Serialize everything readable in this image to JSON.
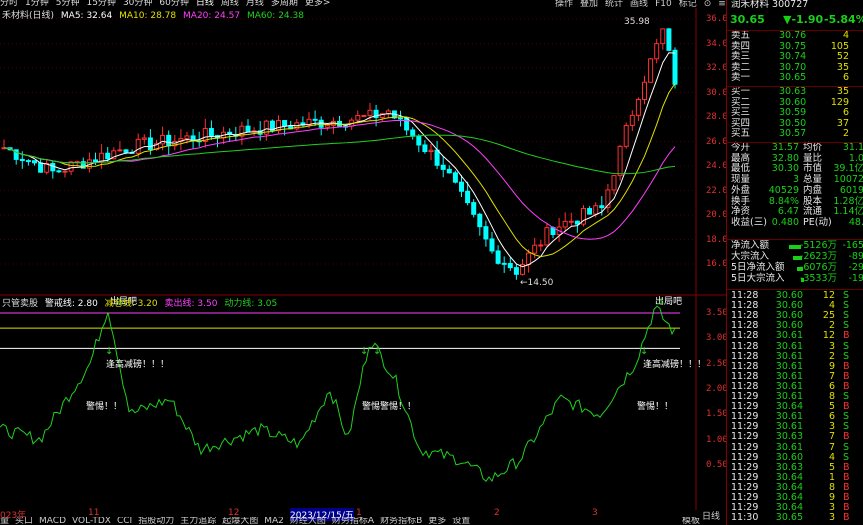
{
  "toolbar": {
    "periods": [
      "分时",
      "1分钟",
      "5分钟",
      "15分钟",
      "30分钟",
      "60分钟",
      "日线",
      "周线",
      "月线",
      "多周期",
      "更多>"
    ],
    "buttons": [
      "操作",
      "叠加",
      "统计",
      "画线",
      "F10",
      "标记",
      "⊙",
      "≡"
    ]
  },
  "header": {
    "stock_name": "润禾材料",
    "code": "300727",
    "price": "30.65",
    "change": "▼-1.90",
    "change_pct": "-5.84%"
  },
  "ma_legend": {
    "title": "禾材料(日线)",
    "ma5": "MA5: 32.64",
    "ma10": "MA10: 28.78",
    "ma20": "MA20: 24.57",
    "ma60": "MA60: 24.38",
    "c5": "#ffffff",
    "c10": "#e0e000",
    "c20": "#ff40ff",
    "c60": "#20d020"
  },
  "ind_legend": {
    "name": "只管卖股",
    "warn": "警戒线: 2.80",
    "cross": "减仓线: 3.20",
    "sell": "卖出线: 3.50",
    "power": "动力线: 3.05"
  },
  "annotations": {
    "high": "35.98",
    "low": "14.50",
    "out": "出局吧",
    "tiny": "逢高减磅！！！",
    "alert": "警惕！！",
    "alert2": "警惕警惕！！",
    "alert3": "警惕！！"
  },
  "y_ticks_main": [
    "36.00",
    "34.00",
    "32.00",
    "30.00",
    "28.00",
    "26.00",
    "24.00",
    "22.00",
    "20.00",
    "18.00",
    "16.00"
  ],
  "y_ticks_ind": [
    "3.50",
    "3.00",
    "2.50",
    "2.00",
    "1.50",
    "1.00",
    "0.50"
  ],
  "x_labels": [
    "023年",
    "11",
    "12",
    "2023/12/15/五",
    "1",
    "2",
    "3"
  ],
  "bottom_tabs": [
    "量",
    "买口",
    "MACD",
    "VOL-TDX",
    "CCI",
    "指股动力",
    "主力追踪",
    "起爆大图",
    "MA2",
    "财经大图",
    "财务指标A",
    "财务指标B",
    "更多",
    "设置"
  ],
  "bottom_right": [
    "模板",
    "日线"
  ],
  "orderbook": {
    "asks": [
      [
        "卖五",
        "30.76",
        "4"
      ],
      [
        "卖四",
        "30.75",
        "105"
      ],
      [
        "卖三",
        "30.74",
        "52"
      ],
      [
        "卖二",
        "30.70",
        "35"
      ],
      [
        "卖一",
        "30.65",
        "6"
      ]
    ],
    "bids": [
      [
        "买一",
        "30.63",
        "35"
      ],
      [
        "买二",
        "30.60",
        "129"
      ],
      [
        "买三",
        "30.59",
        "6"
      ],
      [
        "买四",
        "30.50",
        "37"
      ],
      [
        "买五",
        "30.57",
        "2"
      ]
    ]
  },
  "stats": [
    [
      "今开",
      "31.57",
      "均价",
      "31.1"
    ],
    [
      "最高",
      "32.80",
      "量比",
      "1.0"
    ],
    [
      "最低",
      "30.30",
      "市值",
      "39.1亿"
    ],
    [
      "现量",
      "3",
      "总量",
      "10072"
    ],
    [
      "外盘",
      "40529",
      "内盘",
      "6019"
    ],
    [
      "换手",
      "8.84%",
      "股本",
      "1.28亿"
    ],
    [
      "净资",
      "6.47",
      "流通",
      "1.14亿"
    ],
    [
      "收益(三)",
      "0.480",
      "PE(动)",
      "48."
    ]
  ],
  "flows": [
    [
      "净流入额",
      "-5126万",
      "-165"
    ],
    [
      "大宗流入",
      "-2623万",
      "-89"
    ],
    [
      "5日净流入额",
      "-6076万",
      "-29"
    ],
    [
      "5日大宗流入",
      "-3533万",
      "-19"
    ]
  ],
  "ticks": [
    [
      "11:28",
      "30.60",
      "12",
      "S"
    ],
    [
      "11:28",
      "30.60",
      "4",
      "S"
    ],
    [
      "11:28",
      "30.60",
      "25",
      "S"
    ],
    [
      "11:28",
      "30.60",
      "2",
      "S"
    ],
    [
      "11:28",
      "30.61",
      "12",
      "B"
    ],
    [
      "11:28",
      "30.61",
      "3",
      "S"
    ],
    [
      "11:28",
      "30.61",
      "2",
      "S"
    ],
    [
      "11:28",
      "30.61",
      "9",
      "B"
    ],
    [
      "11:28",
      "30.61",
      "7",
      "B"
    ],
    [
      "11:28",
      "30.61",
      "6",
      "B"
    ],
    [
      "11:29",
      "30.61",
      "8",
      "S"
    ],
    [
      "11:29",
      "30.64",
      "5",
      "B"
    ],
    [
      "11:29",
      "30.61",
      "6",
      "S"
    ],
    [
      "11:29",
      "30.61",
      "3",
      "S"
    ],
    [
      "11:29",
      "30.63",
      "7",
      "B"
    ],
    [
      "11:29",
      "30.61",
      "7",
      "S"
    ],
    [
      "11:29",
      "30.60",
      "4",
      "S"
    ],
    [
      "11:29",
      "30.63",
      "5",
      "B"
    ],
    [
      "11:29",
      "30.64",
      "1",
      "B"
    ],
    [
      "11:29",
      "30.64",
      "8",
      "B"
    ],
    [
      "11:29",
      "30.64",
      "9",
      "B"
    ],
    [
      "11:29",
      "30.64",
      "3",
      "B"
    ],
    [
      "11:30",
      "30.65",
      "3",
      "B"
    ]
  ]
}
